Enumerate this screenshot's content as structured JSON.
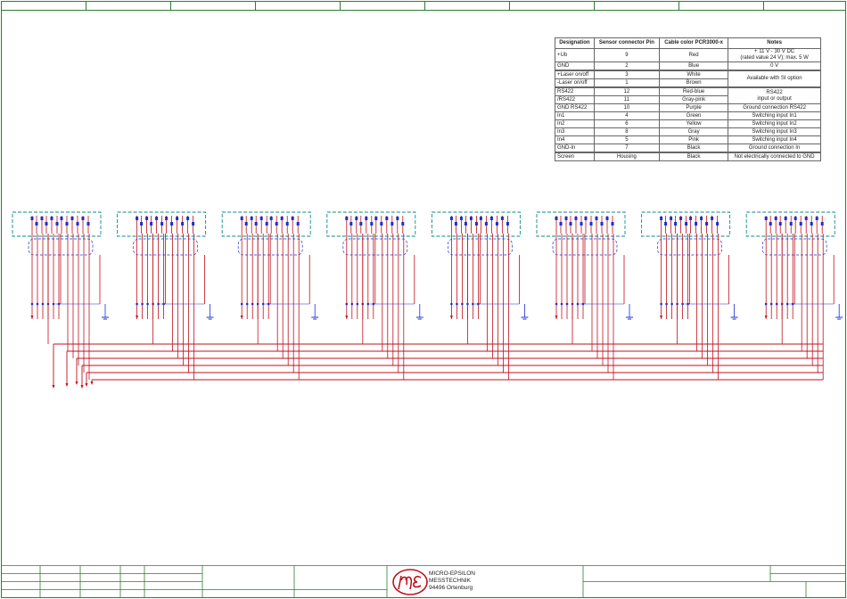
{
  "pin_table": {
    "headers": [
      "Designation",
      "Sensor connector Pin",
      "Cable color PCR3000-x",
      "Notes"
    ],
    "rows": [
      {
        "designation": "+Ub",
        "pin": "9",
        "color": "Red",
        "notes_line1": "+ 11 V - 30 V DC",
        "notes_line2": "(rated value 24 V); max. 5 W",
        "notes_rowspan": 1
      },
      {
        "designation": "GND",
        "pin": "2",
        "color": "Blue",
        "notes_line1": "0 V",
        "notes_line2": "",
        "notes_rowspan": 1
      },
      {
        "designation": "+Laser on/off",
        "pin": "3",
        "color": "White",
        "notes_line1": "Available with SI option",
        "notes_line2": "",
        "notes_rowspan": 2,
        "gap": true
      },
      {
        "designation": "-Laser on/off",
        "pin": "1",
        "color": "Brown",
        "notes_rowspan": 0
      },
      {
        "designation": "RS422",
        "pin": "12",
        "color": "Red-blue",
        "notes_line1": "RS422",
        "notes_line2": "input or output",
        "notes_rowspan": 2,
        "gap": true
      },
      {
        "designation": "/RS422",
        "pin": "11",
        "color": "Gray-pink",
        "notes_rowspan": 0
      },
      {
        "designation": "GND RS422",
        "pin": "10",
        "color": "Purple",
        "notes_line1": "Ground connection RS422",
        "notes_line2": "",
        "notes_rowspan": 1
      },
      {
        "designation": "In1",
        "pin": "4",
        "color": "Green",
        "notes_line1": "Switching input In1",
        "notes_line2": "",
        "notes_rowspan": 1
      },
      {
        "designation": "In2",
        "pin": "6",
        "color": "Yellow",
        "notes_line1": "Switching input In2",
        "notes_line2": "",
        "notes_rowspan": 1
      },
      {
        "designation": "In3",
        "pin": "8",
        "color": "Gray",
        "notes_line1": "Switching input In3",
        "notes_line2": "",
        "notes_rowspan": 1
      },
      {
        "designation": "In4",
        "pin": "5",
        "color": "Pink",
        "notes_line1": "Switching input In4",
        "notes_line2": "",
        "notes_rowspan": 1
      },
      {
        "designation": "GND-In",
        "pin": "7",
        "color": "Black",
        "notes_line1": "Ground connection In",
        "notes_line2": "",
        "notes_rowspan": 1
      },
      {
        "designation": "Screen",
        "pin": "Housing",
        "color": "Black",
        "notes_line1": "Not electrically connected to GND",
        "notes_line2": "",
        "notes_rowspan": 1,
        "gap": true
      }
    ]
  },
  "schematic": {
    "sensor_count": 8,
    "wire_color": "#c0101e",
    "pin_color": "#1a2fd6",
    "box_color": "#0e8a8a"
  },
  "title_block": {
    "company_line1": "MICRO-EPSILON",
    "company_line2": "MESSTECHNIK",
    "company_line3": "94496 Ortenburg",
    "logo_color": "#c0101e"
  }
}
